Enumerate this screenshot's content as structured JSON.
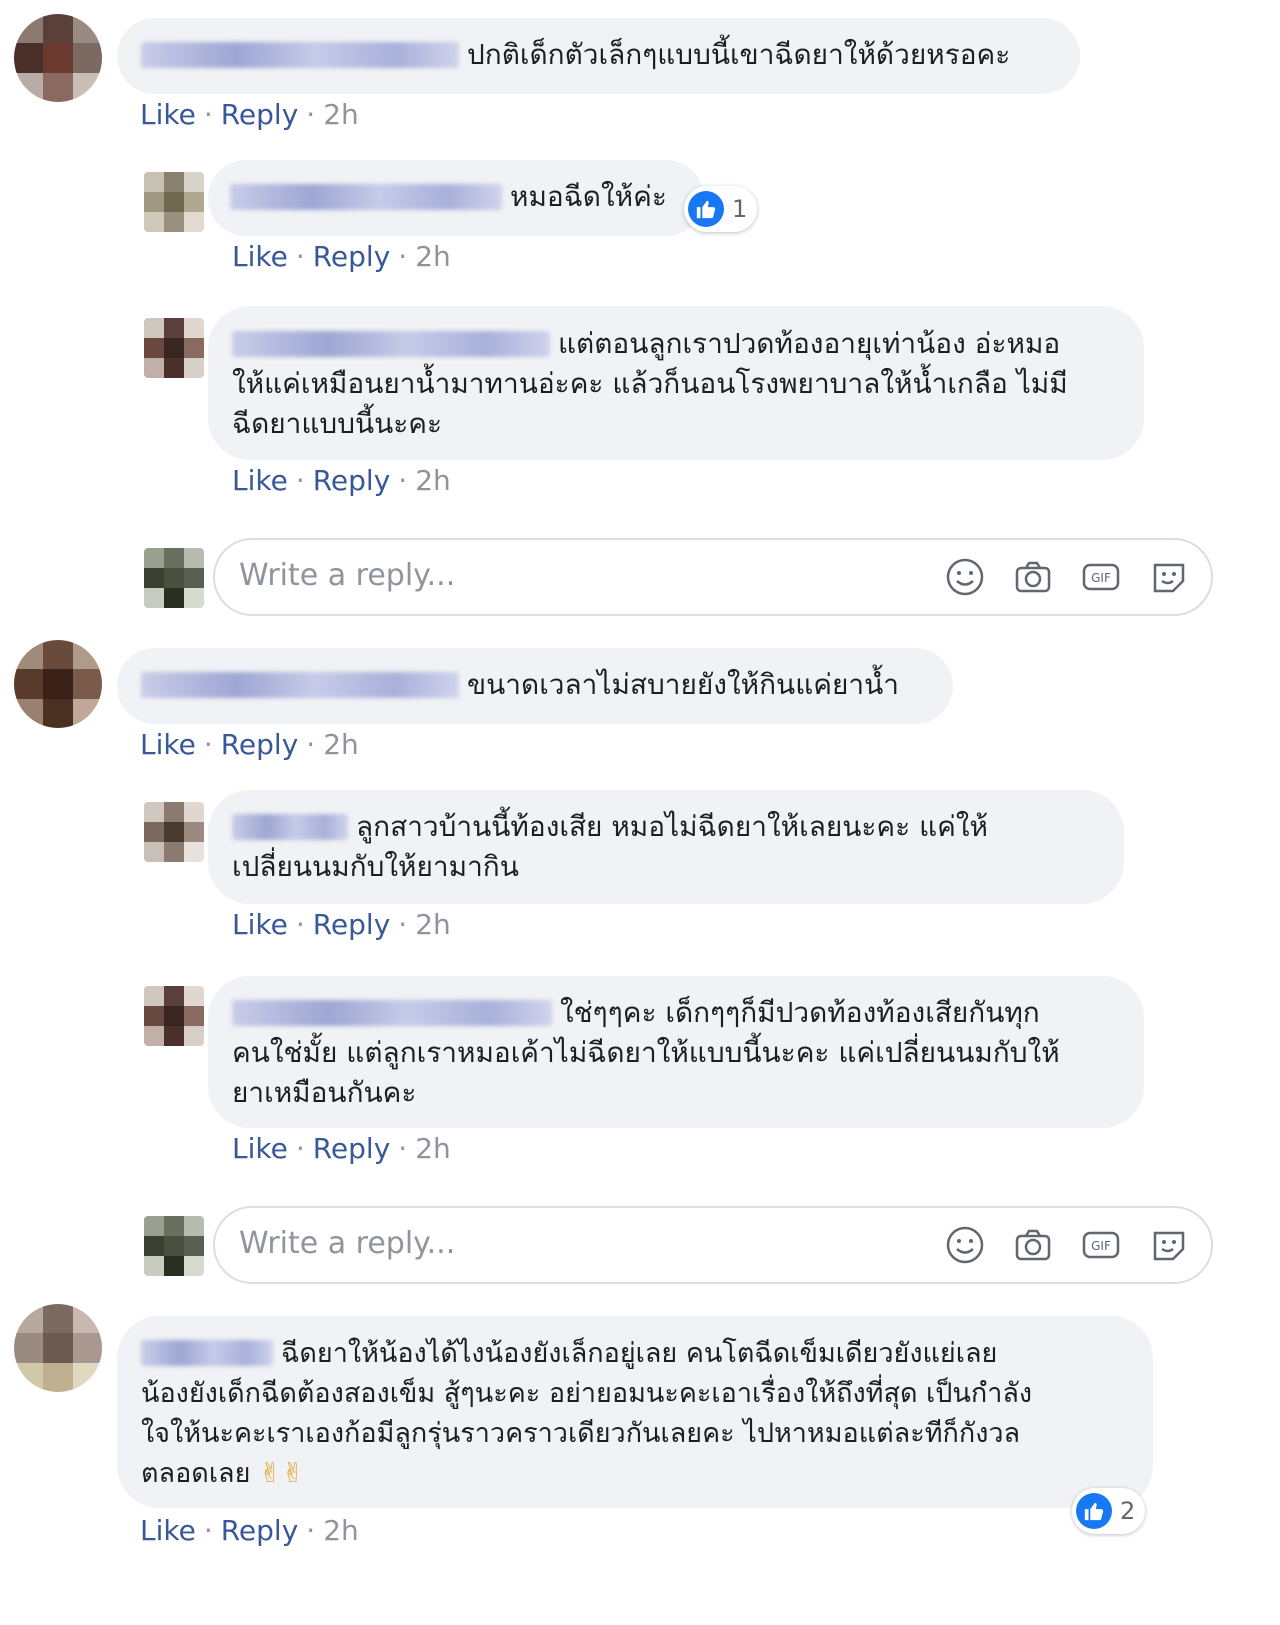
{
  "actions": {
    "like": "Like",
    "reply": "Reply",
    "sep": "·",
    "time": "2h"
  },
  "reply_placeholder": "Write a reply...",
  "comments": [
    {
      "text": "ปกติเด็กตัวเล็กๆแบบนี้เขาฉีดยาให้ด้วยหรอคะ"
    },
    {
      "text": "หมอฉีดให้ค่ะ",
      "reactions": "1"
    },
    {
      "line1": "แต่ตอนลูกเราปวดท้องอายุเท่าน้อง อ่ะหมอ",
      "line2": "ให้แค่เหมือนยาน้ำมาทานอ่ะคะ แล้วก็นอนโรงพยาบาลให้น้ำเกลือ ไม่มี",
      "line3": "ฉีดยาแบบนี้นะคะ"
    },
    {
      "text": "ขนาดเวลาไม่สบายยังให้กินแค่ยาน้ำ"
    },
    {
      "line1": "ลูกสาวบ้านนี้ท้องเสีย หมอไม่ฉีดยาให้เลยนะคะ แค่ให้",
      "line2": "เปลี่ยนนมกับให้ยามากิน"
    },
    {
      "line1": "ใช่ๆๆคะ เด็กๆๆก็มีปวดท้องท้องเสียกันทุก",
      "line2": "คนใช่มั้ย แต่ลูกเราหมอเค้าไม่ฉีดยาให้แบบนี้นะคะ แค่เปลี่ยนนมกับให้",
      "line3": "ยาเหมือนกันคะ"
    },
    {
      "line1": "ฉีดยาให้น้องได้ไงน้องยังเล็กอยู่เลย คนโตฉีดเข็มเดียวยังแย่เลย",
      "line2": "น้องยังเด็กฉีดต้องสองเข็ม สู้ๆนะคะ อย่ายอมนะคะเอาเรื่องให้ถึงที่สุด เป็นกำลัง",
      "line3": "ใจให้นะคะเราเองก้อมีลูกรุ่นราวคราวเดียวกันเลยคะ ไปหาหมอแต่ละทีก็กังวล",
      "line4": "ตลอดเลย",
      "emoji": "✌✌",
      "reactions": "2"
    }
  ]
}
